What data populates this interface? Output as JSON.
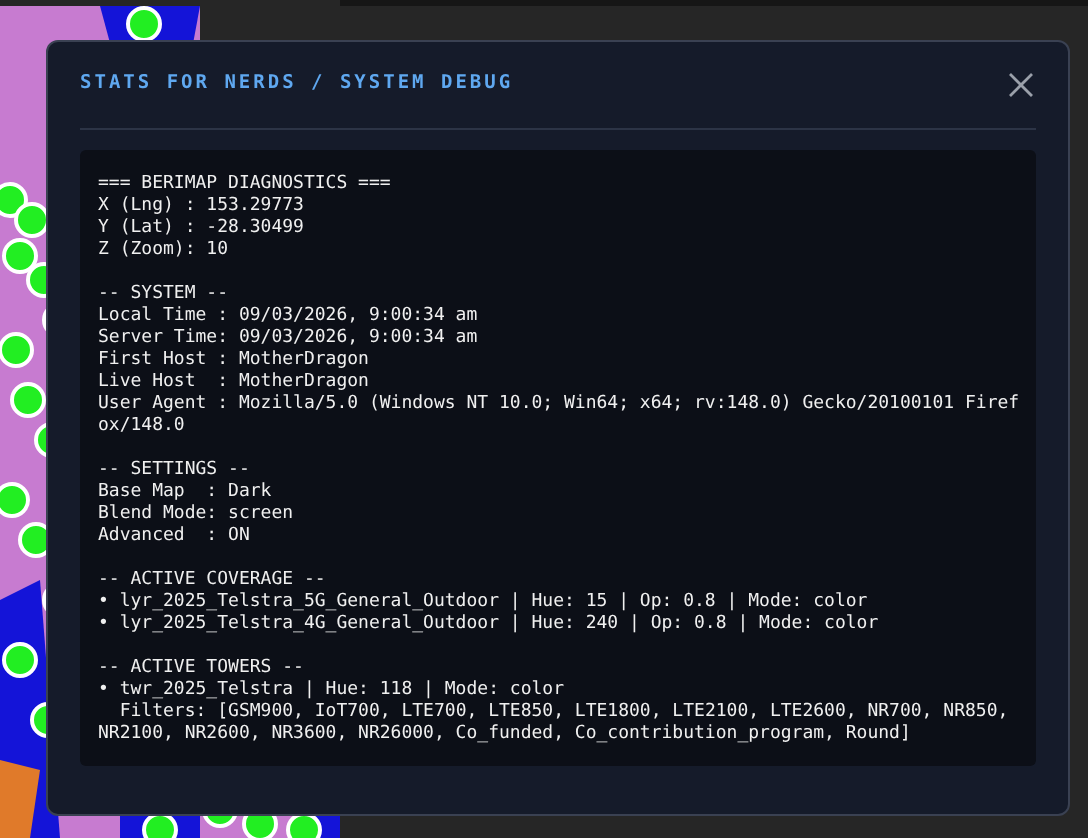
{
  "dialog": {
    "title": "STATS FOR NERDS / SYSTEM DEBUG",
    "sections": [
      {
        "lines": [
          "=== BERIMAP DIAGNOSTICS ===",
          "X (Lng) : 153.29773",
          "Y (Lat) : -28.30499",
          "Z (Zoom): 10"
        ]
      },
      {
        "lines": [
          "-- SYSTEM --",
          "Local Time : 09/03/2026, 9:00:34 am",
          "Server Time: 09/03/2026, 9:00:34 am",
          "First Host : MotherDragon",
          "Live Host  : MotherDragon",
          "User Agent : Mozilla/5.0 (Windows NT 10.0; Win64; x64; rv:148.0) Gecko/20100101 Firefox/148.0"
        ]
      },
      {
        "lines": [
          "-- SETTINGS --",
          "Base Map  : Dark",
          "Blend Mode: screen",
          "Advanced  : ON"
        ]
      },
      {
        "lines": [
          "-- ACTIVE COVERAGE --",
          "• lyr_2025_Telstra_5G_General_Outdoor | Hue: 15 | Op: 0.8 | Mode: color",
          "• lyr_2025_Telstra_4G_General_Outdoor | Hue: 240 | Op: 0.8 | Mode: color"
        ]
      },
      {
        "lines": [
          "-- ACTIVE TOWERS --",
          "• twr_2025_Telstra | Hue: 118 | Mode: color",
          "  Filters: [GSM900, IoT700, LTE700, LTE850, LTE1800, LTE2100, LTE2600, NR700, NR850, NR2100, NR2600, NR3600, NR26000, Co_funded, Co_contribution_program, Round]"
        ]
      }
    ]
  }
}
